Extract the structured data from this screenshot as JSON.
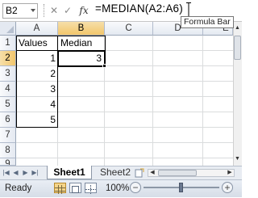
{
  "formula_bar": {
    "name_box": "B2",
    "cancel_glyph": "✕",
    "enter_glyph": "✓",
    "fx_label": "fx",
    "formula": "=MEDIAN(A2:A6)",
    "tooltip": "Formula Bar"
  },
  "columns": [
    "A",
    "B",
    "C",
    "D",
    "E"
  ],
  "rows": [
    "1",
    "2",
    "3",
    "4",
    "5",
    "6",
    "7",
    "8",
    "9"
  ],
  "cells": {
    "a1": "Values",
    "b1": "Median",
    "a2": "1",
    "a3": "2",
    "a4": "3",
    "a5": "4",
    "a6": "5",
    "b2": "3"
  },
  "sheets": [
    "Sheet1",
    "Sheet2"
  ],
  "status": {
    "ready": "Ready",
    "zoom": "100%",
    "zoom_minus": "−",
    "zoom_plus": "+"
  },
  "colors": {
    "selected_header": "#f2c66b",
    "header_bg": "#e4e9f1",
    "gridline": "#dadcdd"
  }
}
